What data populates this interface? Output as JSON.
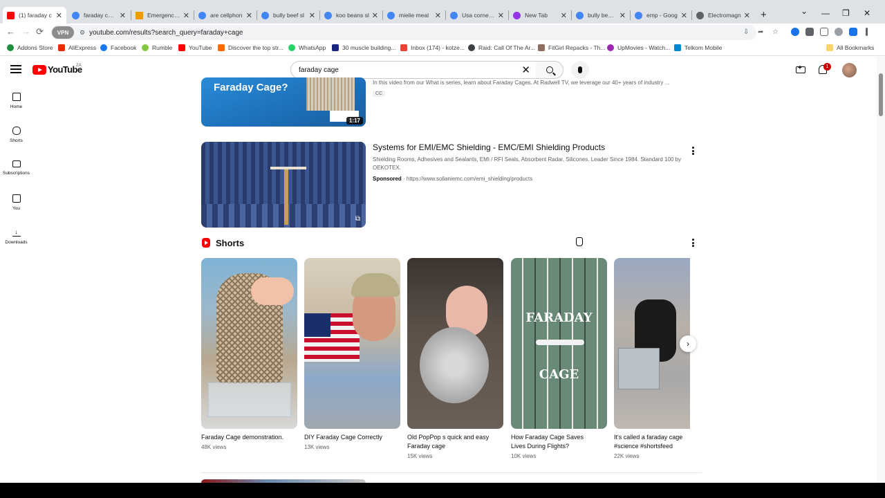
{
  "tabs": [
    {
      "title": "(1) faraday c",
      "color": "#ff0000",
      "active": true
    },
    {
      "title": "faraday cage",
      "color": "#4285f4"
    },
    {
      "title": "Emergency S",
      "color": "#f29900"
    },
    {
      "title": "are cellphon",
      "color": "#4285f4"
    },
    {
      "title": "bully beef sl",
      "color": "#4285f4"
    },
    {
      "title": "koo beans sl",
      "color": "#4285f4"
    },
    {
      "title": "mielie meal",
      "color": "#4285f4"
    },
    {
      "title": "Usa corned b",
      "color": "#4285f4"
    },
    {
      "title": "New Tab",
      "color": "#9334e6"
    },
    {
      "title": "bully beef pr",
      "color": "#4285f4"
    },
    {
      "title": "emp - Goog",
      "color": "#4285f4"
    },
    {
      "title": "Electromagn",
      "color": "#5f6368"
    }
  ],
  "new_tab_label": "+",
  "window": {
    "minimize": "—",
    "maximize": "❐",
    "close": "✕",
    "dropdown": "⌄"
  },
  "nav": {
    "back": "←",
    "forward": "→",
    "reload": "⟳"
  },
  "address": {
    "vpn_label": "VPN",
    "url": "youtube.com/results?search_query=faraday+cage"
  },
  "bookmarks": [
    {
      "label": "Addons Store",
      "color": "#1e8e3e"
    },
    {
      "label": "AliExpress",
      "color": "#e62e04"
    },
    {
      "label": "Facebook",
      "color": "#1877f2"
    },
    {
      "label": "Rumble",
      "color": "#85c742"
    },
    {
      "label": "YouTube",
      "color": "#ff0000"
    },
    {
      "label": "Discover the top str...",
      "color": "#ff6a00"
    },
    {
      "label": "WhatsApp",
      "color": "#25d366"
    },
    {
      "label": "30 muscle building...",
      "color": "#1a237e"
    },
    {
      "label": "Inbox (174) - kotze...",
      "color": "#ea4335"
    },
    {
      "label": "Raid: Call Of The Ar...",
      "color": "#3c4043"
    },
    {
      "label": "FitGirl Repacks - Th...",
      "color": "#8d6e63"
    },
    {
      "label": "UpMovies - Watch...",
      "color": "#9c27b0"
    },
    {
      "label": "Telkom Mobile",
      "color": "#0288d1"
    }
  ],
  "all_bookmarks": "All Bookmarks",
  "yt": {
    "logo_text": "YouTube",
    "country": "ZA",
    "search_value": "faraday cage",
    "notification_count": "1"
  },
  "guide": [
    {
      "label": "Home",
      "icon": "home-icon"
    },
    {
      "label": "Shorts",
      "icon": "shorts-icon"
    },
    {
      "label": "Subscriptions",
      "icon": "subscriptions-icon"
    },
    {
      "label": "You",
      "icon": "you-icon"
    },
    {
      "label": "Downloads",
      "icon": "downloads-icon"
    }
  ],
  "video1": {
    "thumb_text": "Faraday Cage?",
    "duration": "1:17",
    "desc": "In this video from our What is series, learn about Faraday Cages. At Radwell TV, we leverage our 40+ years of industry ...",
    "badge": "CC"
  },
  "ad": {
    "title": "Systems for EMI/EMC Shielding - EMC/EMI Shielding Products",
    "desc1": "Shielding Rooms, Adhesives and Sealants, EMI / RFI Seals, Absorbent Radar, Silicones. Leader Since 1984. Standard 100 by",
    "desc2": "OEKOTEX.",
    "sponsored": "Sponsored",
    "url": "· https://www.solianiemc.com/emi_shielding/products"
  },
  "shorts": {
    "heading": "Shorts",
    "items": [
      {
        "title": "Faraday Cage demonstration.",
        "views": "48K views"
      },
      {
        "title": "DIY Faraday Cage Correctly",
        "views": "13K views"
      },
      {
        "title": "Old PopPop s quick and easy Faraday cage",
        "views": "15K views"
      },
      {
        "title": "How Faraday Cage Saves Lives During Flights?",
        "views": "10K views",
        "overlay1": "FARADAY",
        "overlay2": "CAGE"
      },
      {
        "title": "It's called a faraday cage #science #shortsfeed",
        "views": "22K views"
      }
    ]
  },
  "colors": {
    "yt_red": "#ff0000",
    "text_primary": "#0f0f0f",
    "text_secondary": "#606060"
  }
}
